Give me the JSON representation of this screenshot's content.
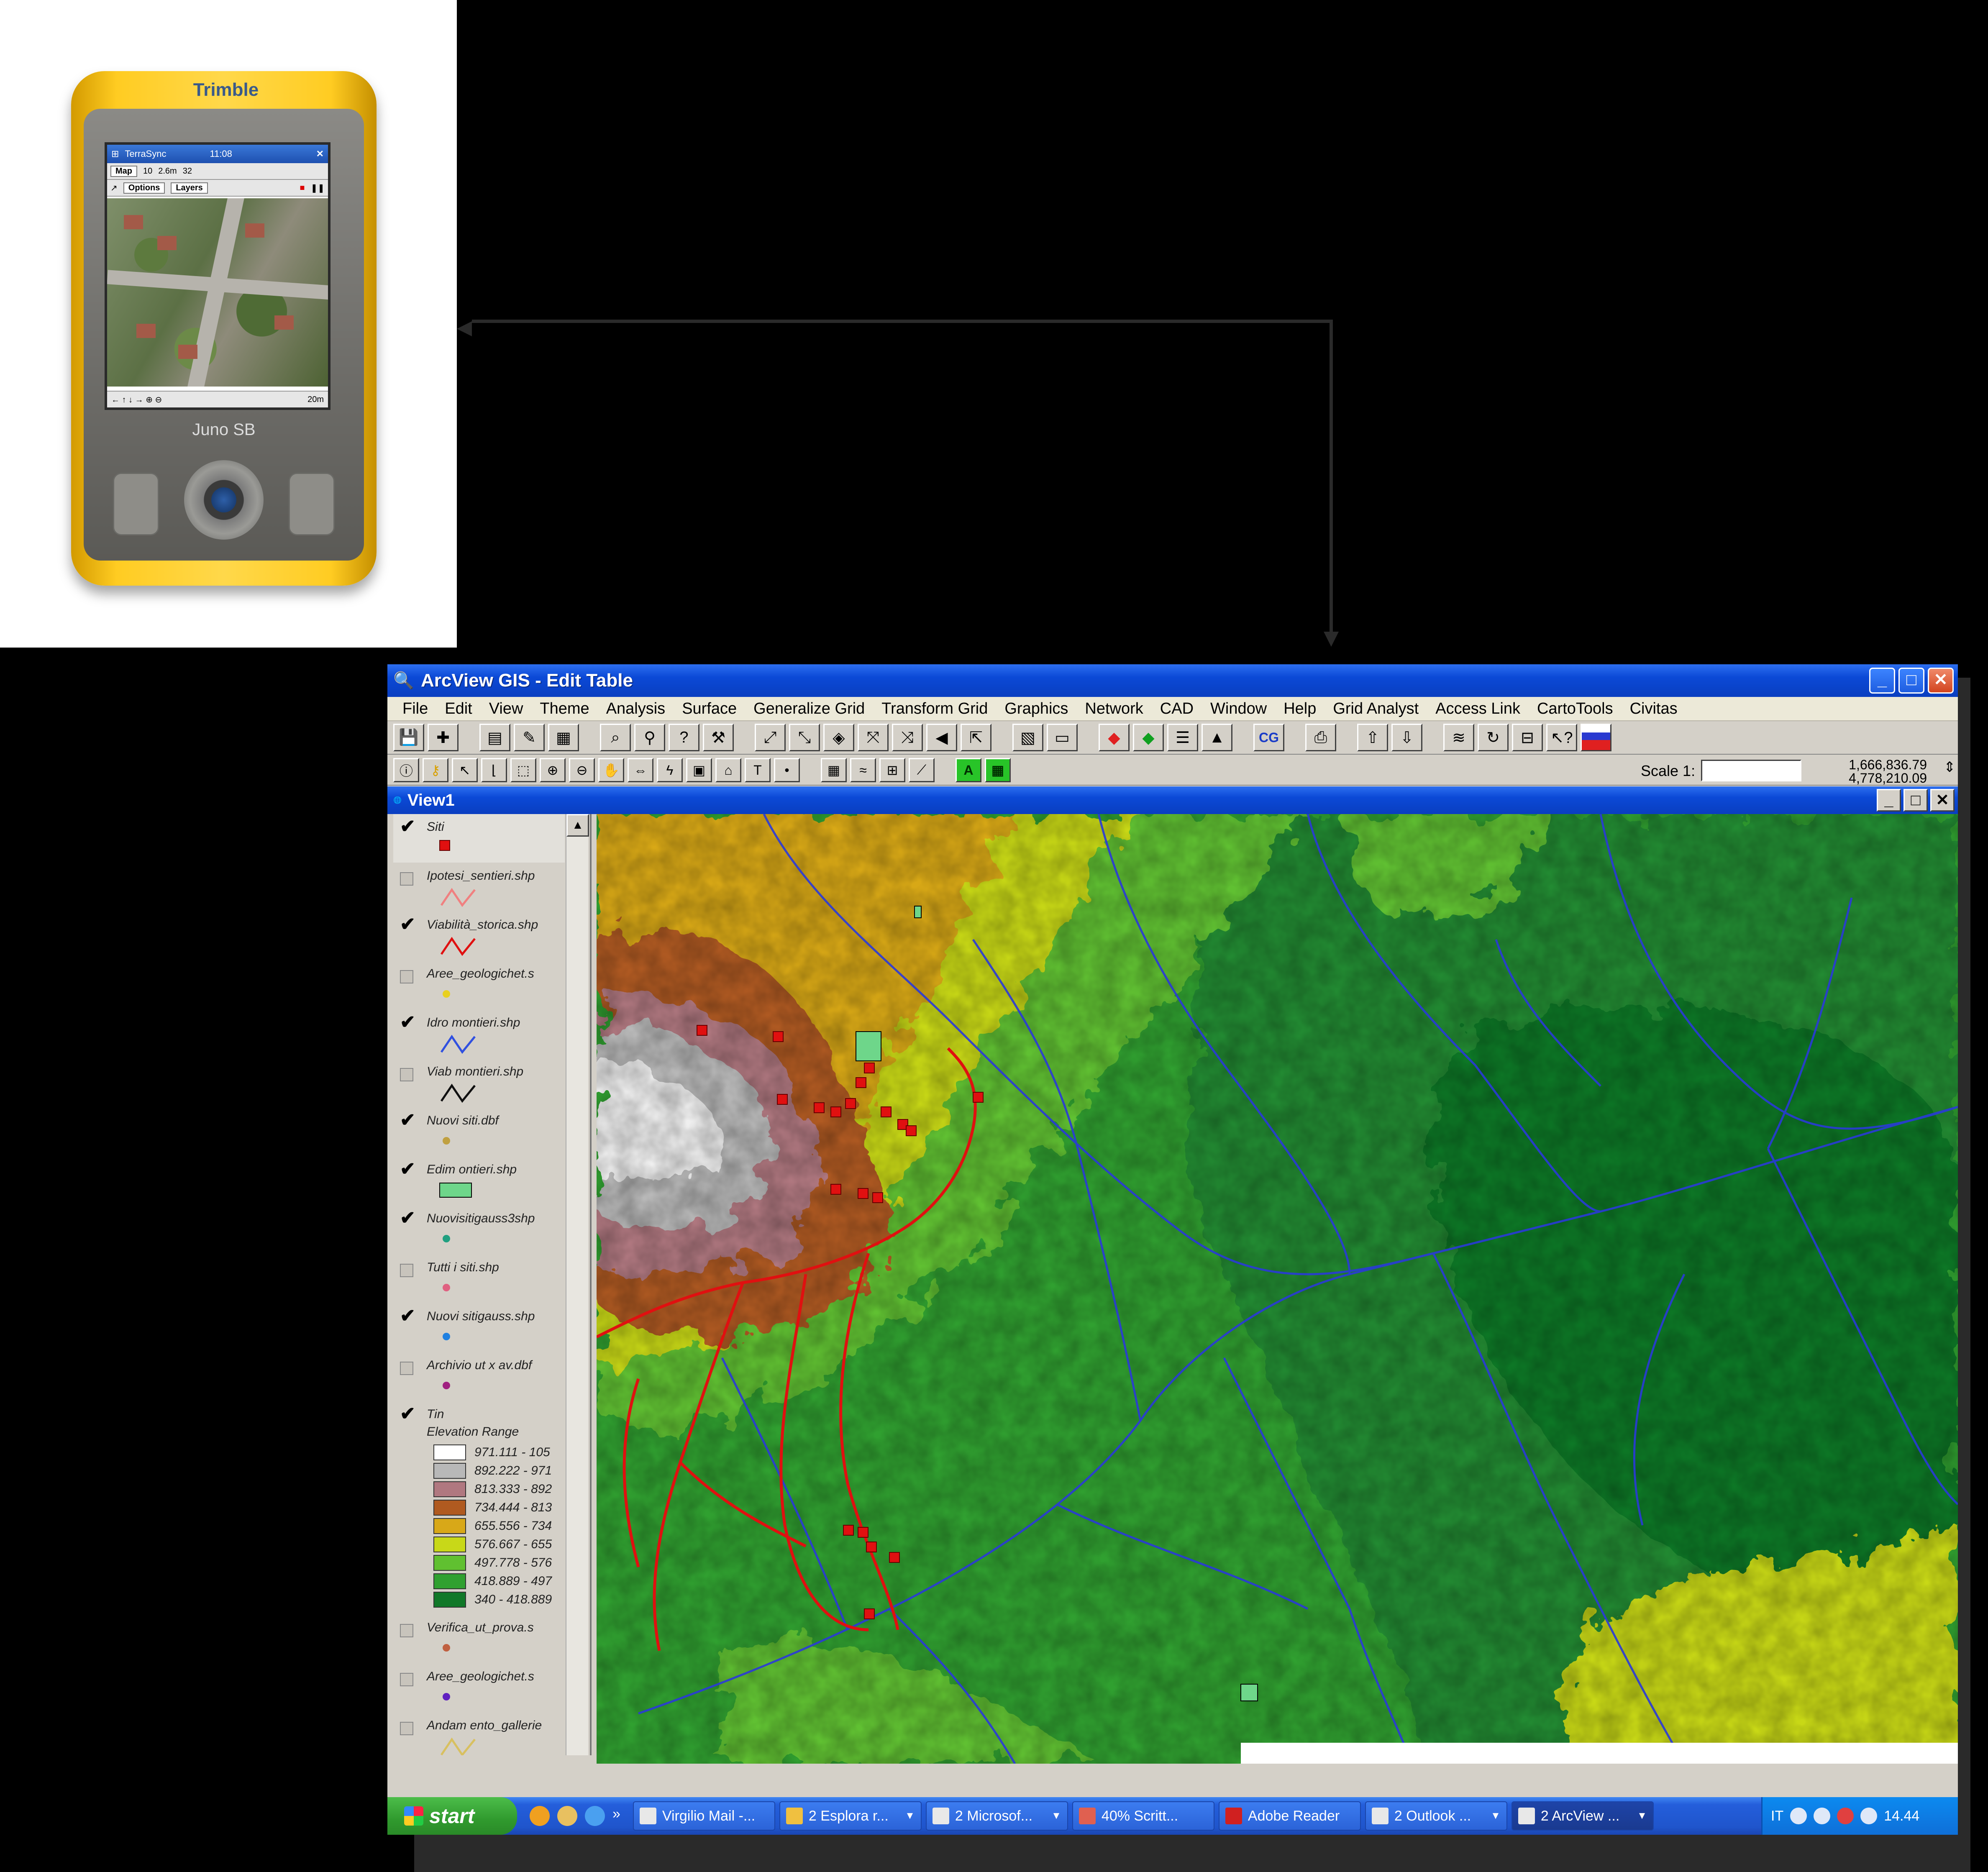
{
  "device": {
    "brand": "Trimble",
    "model": "Juno SB",
    "app_title": "TerraSync",
    "clock": "11:08",
    "map_button": "Map",
    "satellites": "10",
    "accuracy": "2.6m",
    "count": "32",
    "options_label": "Options",
    "layers_label": "Layers",
    "scale_label": "20m"
  },
  "window": {
    "title": "ArcView GIS - Edit Table",
    "menu": [
      "File",
      "Edit",
      "View",
      "Theme",
      "Analysis",
      "Surface",
      "Generalize Grid",
      "Transform Grid",
      "Graphics",
      "Network",
      "CAD",
      "Window",
      "Help",
      "Grid Analyst",
      "Access Link",
      "CartoTools",
      "Civitas"
    ],
    "scale_label": "Scale 1:",
    "scale_value": "",
    "coord_x": "1,666,836.79",
    "coord_y": "4,778,210.09",
    "cg_label": "CG"
  },
  "view": {
    "title": "View1",
    "layers": [
      {
        "name": "Siti",
        "checked": true,
        "symbol": "square",
        "color": "#e01010"
      },
      {
        "name": "Ipotesi_sentieri.shp",
        "checked": false,
        "symbol": "line",
        "color": "#f08080"
      },
      {
        "name": "Viabilità_storica.shp",
        "checked": true,
        "symbol": "line",
        "color": "#e01010"
      },
      {
        "name": "Aree_geologichet.s",
        "checked": false,
        "symbol": "dot",
        "color": "#e8d020"
      },
      {
        "name": "Idro montieri.shp",
        "checked": true,
        "symbol": "line",
        "color": "#3050e0"
      },
      {
        "name": "Viab montieri.shp",
        "checked": false,
        "symbol": "line",
        "color": "#101010"
      },
      {
        "name": "Nuovi siti.dbf",
        "checked": true,
        "symbol": "dot",
        "color": "#c0a040"
      },
      {
        "name": "Edim ontieri.shp",
        "checked": true,
        "symbol": "rect",
        "color": "#6ed68a"
      },
      {
        "name": "Nuovisitigauss3shp",
        "checked": true,
        "symbol": "dot",
        "color": "#20a080"
      },
      {
        "name": "Tutti i siti.shp",
        "checked": false,
        "symbol": "dot",
        "color": "#e06080"
      },
      {
        "name": "Nuovi sitigauss.shp",
        "checked": true,
        "symbol": "dot",
        "color": "#2080e0"
      },
      {
        "name": "Archivio ut x av.dbf",
        "checked": false,
        "symbol": "dot",
        "color": "#a02080"
      }
    ],
    "tin": {
      "name": "Tin",
      "checked": true,
      "range_title": "Elevation Range",
      "ranges": [
        {
          "label": "971.111 - 105",
          "color": "#ffffff"
        },
        {
          "label": "892.222 - 971",
          "color": "#b8b8b8"
        },
        {
          "label": "813.333 - 892",
          "color": "#b07880"
        },
        {
          "label": "734.444 - 813",
          "color": "#b05a20"
        },
        {
          "label": "655.556 - 734",
          "color": "#d8a818"
        },
        {
          "label": "576.667 - 655",
          "color": "#c8d818"
        },
        {
          "label": "497.778 - 576",
          "color": "#60c030"
        },
        {
          "label": "418.889 - 497",
          "color": "#30a030"
        },
        {
          "label": "340 - 418.889",
          "color": "#107828"
        }
      ]
    },
    "layers_after": [
      {
        "name": "Verifica_ut_prova.s",
        "checked": false,
        "symbol": "dot",
        "color": "#c06040"
      },
      {
        "name": "Aree_geologichet.s",
        "checked": false,
        "symbol": "dot",
        "color": "#6020c0"
      },
      {
        "name": "Andam ento_gallerie",
        "checked": false,
        "symbol": "line",
        "color": "#d8c060"
      }
    ]
  },
  "taskbar": {
    "start": "start",
    "tasks": [
      {
        "label": "Virgilio Mail -...",
        "active": false
      },
      {
        "label": "2 Esplora r...",
        "active": false
      },
      {
        "label": "2 Microsof...",
        "active": false
      },
      {
        "label": "40% Scritt...",
        "active": false
      },
      {
        "label": "Adobe Reader",
        "active": false
      },
      {
        "label": "2 Outlook ...",
        "active": false
      },
      {
        "label": "2 ArcView ...",
        "active": true
      }
    ],
    "lang": "IT",
    "clock": "14.44"
  }
}
